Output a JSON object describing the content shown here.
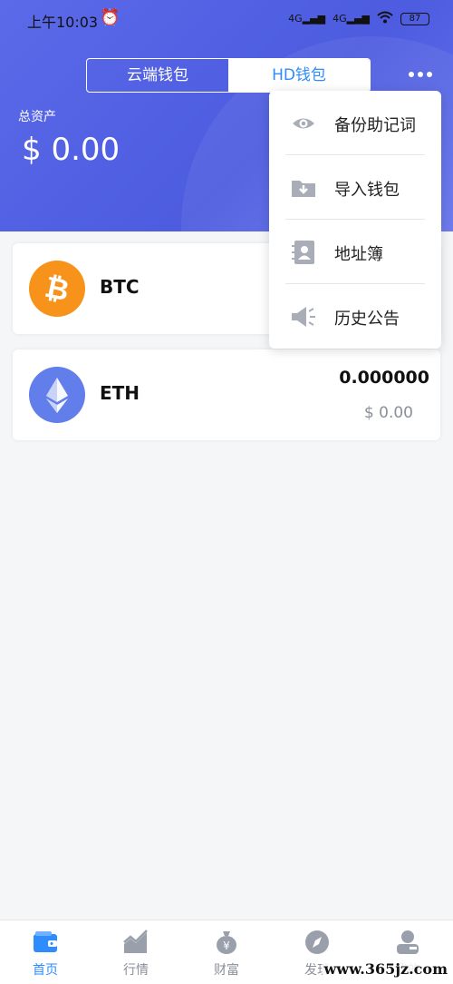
{
  "status_bar": {
    "time": "上午10:03",
    "signal1": "4G",
    "signal2": "4G",
    "battery": "87"
  },
  "header": {
    "tabs": [
      {
        "label": "云端钱包",
        "active": false
      },
      {
        "label": "HD钱包",
        "active": true
      }
    ],
    "total_label": "总资产",
    "total_value": "$ 0.00"
  },
  "coins": [
    {
      "name": "BTC",
      "amount": "",
      "usd": "",
      "icon": "bitcoin-icon",
      "color": "#f7931a"
    },
    {
      "name": "ETH",
      "amount": "0.000000",
      "usd": "$ 0.00",
      "icon": "ethereum-icon",
      "color": "#627eea"
    }
  ],
  "menu": {
    "items": [
      {
        "label": "备份助记词",
        "icon": "eye-icon"
      },
      {
        "label": "导入钱包",
        "icon": "folder-download-icon"
      },
      {
        "label": "地址簿",
        "icon": "contact-book-icon"
      },
      {
        "label": "历史公告",
        "icon": "megaphone-icon"
      }
    ]
  },
  "tabbar": {
    "items": [
      {
        "label": "首页",
        "icon": "wallet-icon",
        "active": true
      },
      {
        "label": "行情",
        "icon": "trend-chart-icon",
        "active": false
      },
      {
        "label": "财富",
        "icon": "money-bag-icon",
        "active": false
      },
      {
        "label": "发现",
        "icon": "compass-icon",
        "active": false
      },
      {
        "label": "我的",
        "icon": "user-icon",
        "active": false
      }
    ]
  },
  "watermark": "www.365jz.com",
  "colors": {
    "accent": "#2f8cff",
    "header_bg": "#4d5ce0",
    "menu_icon": "#a9adb8"
  }
}
